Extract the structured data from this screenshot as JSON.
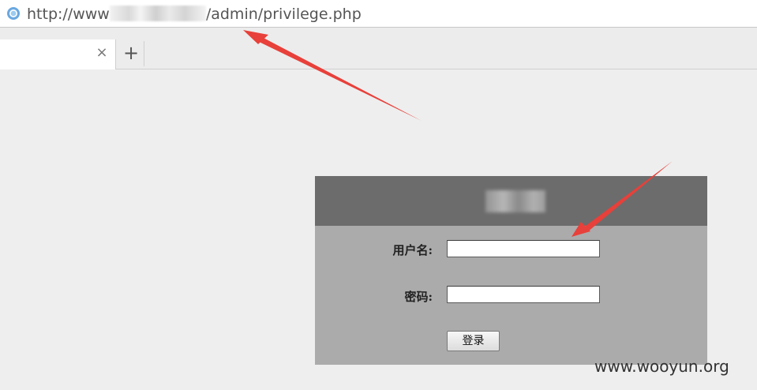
{
  "address_bar": {
    "url_prefix": "http://www",
    "url_suffix": "/admin/privilege.php",
    "icon": "site-globe-icon"
  },
  "tabs": {
    "close_glyph": "×",
    "new_tab_glyph": "+"
  },
  "login": {
    "username_label": "用户名:",
    "password_label": "密码:",
    "submit_label": "登录"
  },
  "watermark": "www.wooyun.org",
  "colors": {
    "annotation_arrow": "#e8403a",
    "panel_header": "#6c6c6c",
    "panel_body": "#ababab",
    "page_background": "#eeeeee"
  }
}
